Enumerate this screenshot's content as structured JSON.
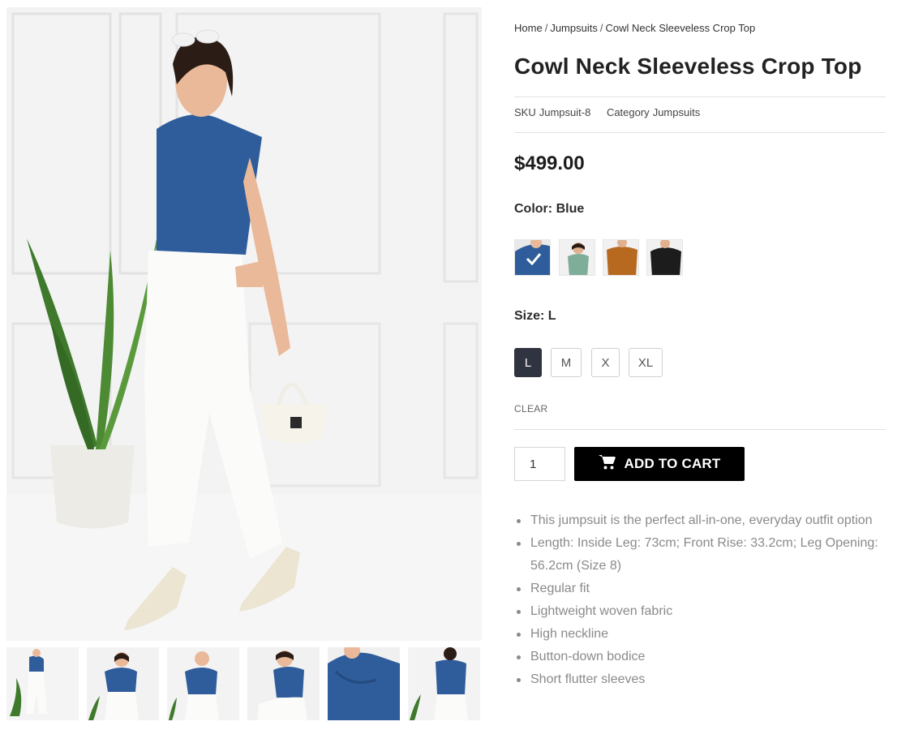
{
  "breadcrumb": {
    "home": "Home",
    "category": "Jumpsuits",
    "current": "Cowl Neck Sleeveless Crop Top",
    "separator": "/"
  },
  "product": {
    "title": "Cowl Neck Sleeveless Crop Top",
    "sku_label": "SKU",
    "sku": "Jumpsuit-8",
    "category_label": "Category",
    "category": "Jumpsuits",
    "price": "$499.00"
  },
  "color": {
    "label": "Color:",
    "selected": "Blue",
    "swatch_colors": [
      "#2f5c9a",
      "#7fae98",
      "#b7691f",
      "#1c1c1c"
    ]
  },
  "size": {
    "label": "Size:",
    "selected": "L",
    "options": [
      "L",
      "M",
      "X",
      "XL"
    ],
    "clear_label": "CLEAR"
  },
  "cart": {
    "quantity": "1",
    "button_label": "ADD TO CART",
    "icon": "cart-icon"
  },
  "features": [
    "This jumpsuit is the perfect all-in-one, everyday outfit option",
    "Length: Inside Leg: 73cm; Front Rise: 33.2cm; Leg Opening: 56.2cm (Size 8)",
    "Regular fit",
    "Lightweight woven fabric",
    "High neckline",
    "Button-down bodice",
    "Short flutter sleeves"
  ],
  "colors": {
    "top_blue": "#2f5c9a",
    "button_bg": "#000000",
    "size_active_bg": "#2f3440"
  }
}
